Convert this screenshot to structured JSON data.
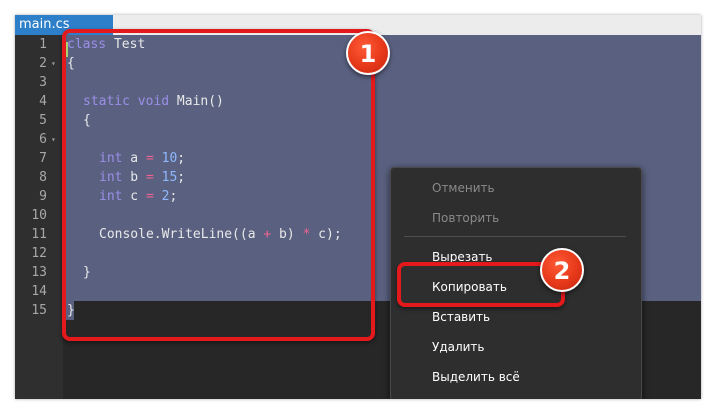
{
  "tab": {
    "label": "main.cs"
  },
  "line_numbers": [
    "1",
    "2",
    "3",
    "4",
    "5",
    "6",
    "7",
    "8",
    "9",
    "10",
    "11",
    "12",
    "13",
    "14",
    "15"
  ],
  "code": {
    "l1_kw": "class",
    "l1_name": " Test",
    "l2": "{",
    "l4_kw": "static void",
    "l4_rest": " Main()",
    "l5": "{",
    "l7_kw": "int",
    "l7_var": " a ",
    "l7_op": "=",
    "l7_num": " 10",
    "l7_end": ";",
    "l8_kw": "int",
    "l8_var": " b ",
    "l8_op": "=",
    "l8_num": " 15",
    "l8_end": ";",
    "l9_kw": "int",
    "l9_var": " c ",
    "l9_op": "=",
    "l9_num": " 2",
    "l9_end": ";",
    "l11_a": "Console.WriteLine((a ",
    "l11_op1": "+",
    "l11_b": " b) ",
    "l11_op2": "*",
    "l11_c": " c);",
    "l13": "}",
    "l15": "}"
  },
  "context_menu": {
    "undo": "Отменить",
    "redo": "Повторить",
    "cut": "Вырезать",
    "copy": "Копировать",
    "paste": "Вставить",
    "delete": "Удалить",
    "select_all": "Выделить всё"
  },
  "annotations": {
    "badge1": "1",
    "badge2": "2"
  },
  "colors": {
    "selection": "#5a6180",
    "keyword": "#9c8ee8",
    "number": "#8fb7ff",
    "operator": "#f06292",
    "highlight": "#e3191c",
    "tab_active": "#2d7fc9"
  }
}
